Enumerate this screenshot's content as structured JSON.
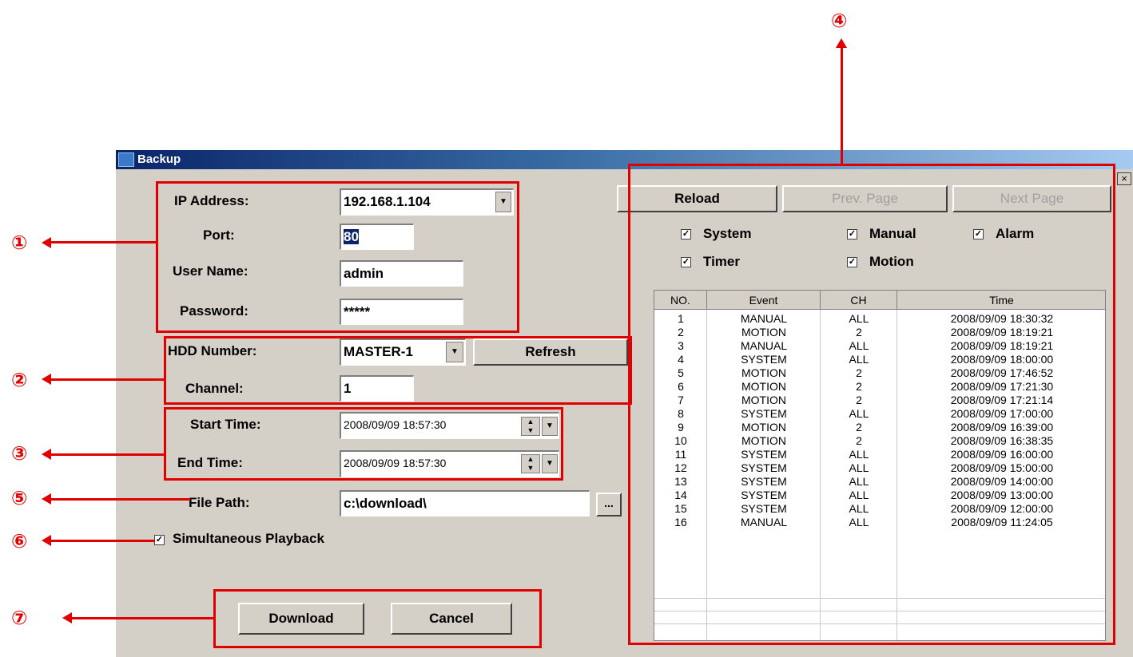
{
  "window": {
    "title": "Backup",
    "close_glyph": "×"
  },
  "connection": {
    "ip_label": "IP Address:",
    "ip_value": "192.168.1.104",
    "port_label": "Port:",
    "port_value": "80",
    "user_label": "User Name:",
    "user_value": "admin",
    "password_label": "Password:",
    "password_value": "*****"
  },
  "hdd": {
    "hdd_label": "HDD Number:",
    "hdd_value": "MASTER-1",
    "refresh_label": "Refresh",
    "channel_label": "Channel:",
    "channel_value": "1"
  },
  "time": {
    "start_label": "Start Time:",
    "start_value": "2008/09/09 18:57:30",
    "end_label": "End Time:",
    "end_value": "2008/09/09 18:57:30"
  },
  "file": {
    "path_label": "File Path:",
    "path_value": "c:\\download\\",
    "browse_label": "..."
  },
  "playback": {
    "label": "Simultaneous Playback",
    "checked": true
  },
  "actions": {
    "download_label": "Download",
    "cancel_label": "Cancel"
  },
  "event_panel": {
    "reload_label": "Reload",
    "prev_label": "Prev. Page",
    "next_label": "Next Page",
    "filters": [
      {
        "label": "System",
        "checked": true
      },
      {
        "label": "Manual",
        "checked": true
      },
      {
        "label": "Alarm",
        "checked": true
      },
      {
        "label": "Timer",
        "checked": true
      },
      {
        "label": "Motion",
        "checked": true
      }
    ],
    "columns": [
      "NO.",
      "Event",
      "CH",
      "Time"
    ],
    "rows": [
      [
        "1",
        "MANUAL",
        "ALL",
        "2008/09/09 18:30:32"
      ],
      [
        "2",
        "MOTION",
        "2",
        "2008/09/09 18:19:21"
      ],
      [
        "3",
        "MANUAL",
        "ALL",
        "2008/09/09 18:19:21"
      ],
      [
        "4",
        "SYSTEM",
        "ALL",
        "2008/09/09 18:00:00"
      ],
      [
        "5",
        "MOTION",
        "2",
        "2008/09/09 17:46:52"
      ],
      [
        "6",
        "MOTION",
        "2",
        "2008/09/09 17:21:30"
      ],
      [
        "7",
        "MOTION",
        "2",
        "2008/09/09 17:21:14"
      ],
      [
        "8",
        "SYSTEM",
        "ALL",
        "2008/09/09 17:00:00"
      ],
      [
        "9",
        "MOTION",
        "2",
        "2008/09/09 16:39:00"
      ],
      [
        "10",
        "MOTION",
        "2",
        "2008/09/09 16:38:35"
      ],
      [
        "11",
        "SYSTEM",
        "ALL",
        "2008/09/09 16:00:00"
      ],
      [
        "12",
        "SYSTEM",
        "ALL",
        "2008/09/09 15:00:00"
      ],
      [
        "13",
        "SYSTEM",
        "ALL",
        "2008/09/09 14:00:00"
      ],
      [
        "14",
        "SYSTEM",
        "ALL",
        "2008/09/09 13:00:00"
      ],
      [
        "15",
        "SYSTEM",
        "ALL",
        "2008/09/09 12:00:00"
      ],
      [
        "16",
        "MANUAL",
        "ALL",
        "2008/09/09 11:24:05"
      ]
    ]
  },
  "callouts": [
    "①",
    "②",
    "③",
    "④",
    "⑤",
    "⑥",
    "⑦"
  ],
  "colors": {
    "annotation": "#e00000",
    "dialog_bg": "#d4d0c8",
    "title_start": "#0a246a",
    "title_end": "#a6caf0"
  }
}
